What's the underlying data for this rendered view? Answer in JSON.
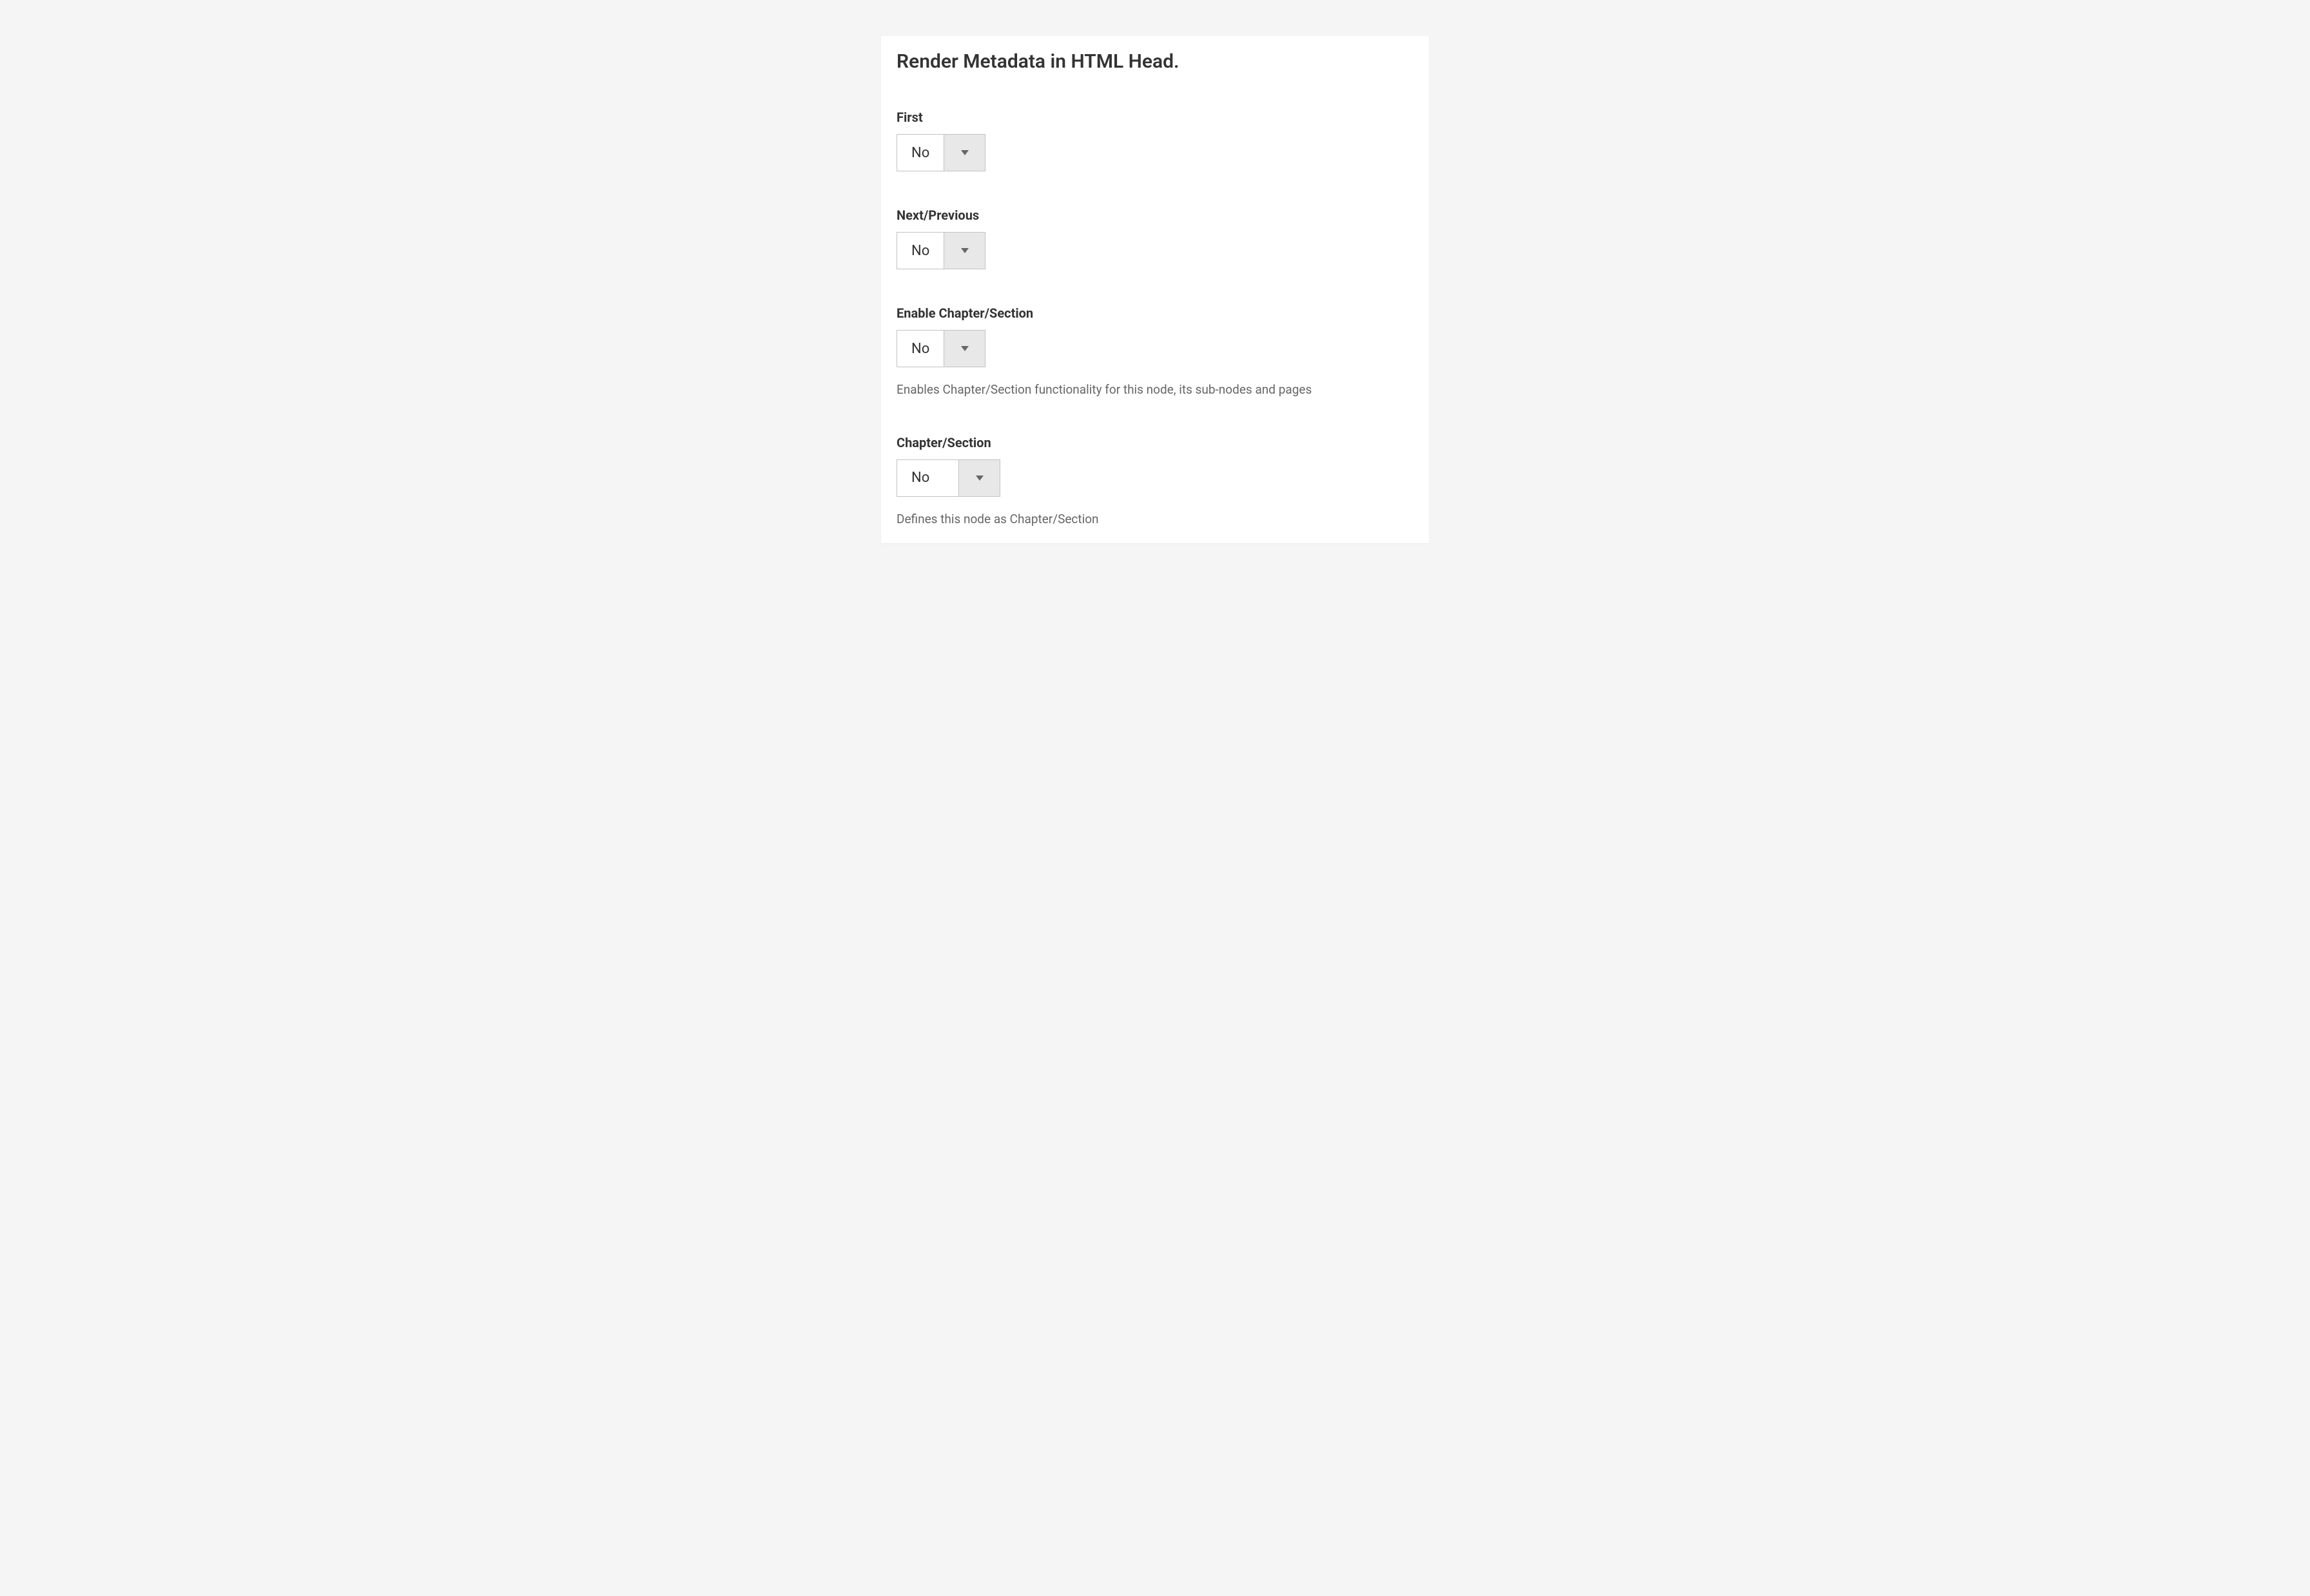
{
  "panel": {
    "title": "Render Metadata in HTML Head."
  },
  "fields": {
    "first": {
      "label": "First",
      "value": "No"
    },
    "next_previous": {
      "label": "Next/Previous",
      "value": "No"
    },
    "enable_chapter_section": {
      "label": "Enable Chapter/Section",
      "value": "No",
      "help": "Enables Chapter/Section functionality for this node, its sub-nodes and pages"
    },
    "chapter_section": {
      "label": "Chapter/Section",
      "value": "No",
      "help": "Defines this node as Chapter/Section"
    }
  }
}
